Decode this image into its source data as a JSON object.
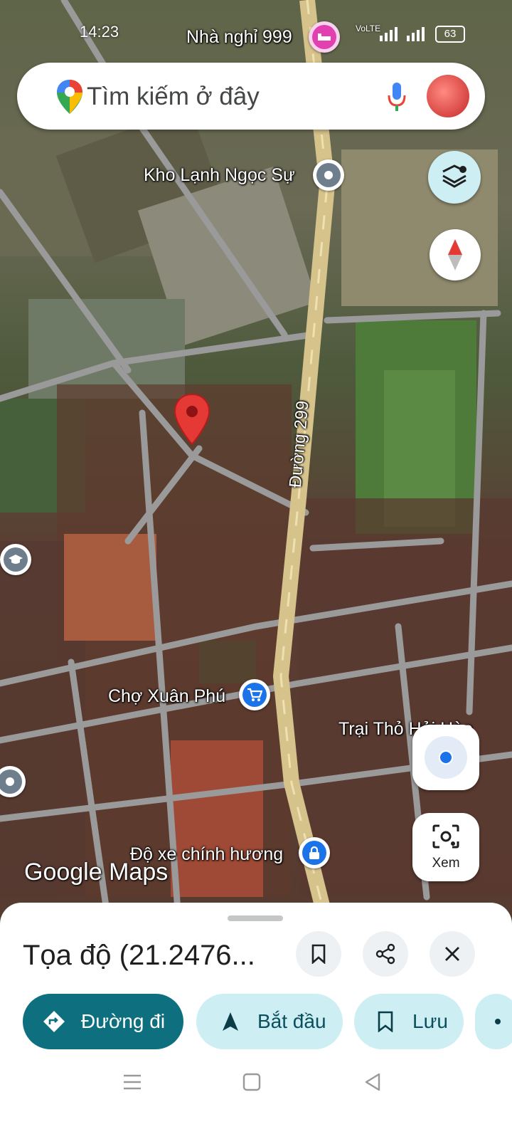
{
  "status_bar": {
    "time": "14:23",
    "battery": "63",
    "network": "VoLTE"
  },
  "search": {
    "placeholder": "Tìm kiếm ở đây"
  },
  "map": {
    "labels": {
      "nha_nghi": "Nhà nghỉ 999",
      "kho_lanh": "Kho Lạnh Ngọc Sự",
      "duong": "Đường 299",
      "cho": "Chợ Xuân Phú",
      "trai_tho": "Trại Thỏ Hải Hào",
      "do_xe": "Độ xe chính hương"
    },
    "watermark": "Google Maps",
    "view_button": "Xem"
  },
  "sheet": {
    "title": "Tọa độ (21.2476...",
    "actions": {
      "directions": "Đường đi",
      "start": "Bắt đầu",
      "save": "Lưu"
    }
  },
  "colors": {
    "accent": "#0e6f7e",
    "pin": "#e53935",
    "road_main": "#d6c28b",
    "road_minor": "#9a9a9a"
  }
}
